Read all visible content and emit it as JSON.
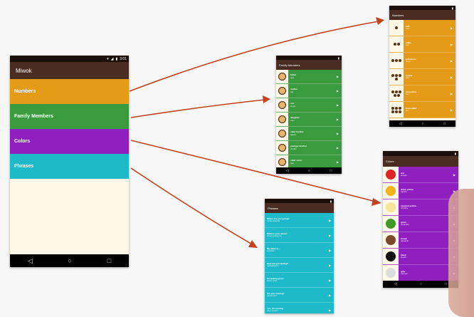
{
  "main": {
    "status_time": "3:01",
    "title": "Miwok",
    "categories": [
      {
        "label": "Numbers",
        "color": "#e39b18"
      },
      {
        "label": "Family Members",
        "color": "#3a9a3e"
      },
      {
        "label": "Colors",
        "color": "#8f1fbf"
      },
      {
        "label": "Phrases",
        "color": "#1fbac9"
      }
    ]
  },
  "numbers_screen": {
    "title": "Numbers",
    "color": "#e39b18",
    "items": [
      {
        "miwok": "lutti",
        "english": "one"
      },
      {
        "miwok": "otiiko",
        "english": "two"
      },
      {
        "miwok": "tolookosu",
        "english": "three"
      },
      {
        "miwok": "oyyisa",
        "english": "four"
      },
      {
        "miwok": "massokka",
        "english": "five"
      },
      {
        "miwok": "temmokka",
        "english": "six"
      }
    ]
  },
  "family_screen": {
    "title": "Family Members",
    "color": "#3a9a3e",
    "items": [
      {
        "miwok": "father",
        "english": "әpә"
      },
      {
        "miwok": "mother",
        "english": "әṭa"
      },
      {
        "miwok": "son",
        "english": "angsi"
      },
      {
        "miwok": "daughter",
        "english": "tune"
      },
      {
        "miwok": "older brother",
        "english": "taachi"
      },
      {
        "miwok": "younger brother",
        "english": "chalitti"
      },
      {
        "miwok": "older sister",
        "english": "teṭe"
      }
    ]
  },
  "colors_screen": {
    "title": "Colors",
    "color": "#8f1fbf",
    "items": [
      {
        "miwok": "red",
        "english": "weṭeṭṭi",
        "swatch": "#e02424"
      },
      {
        "miwok": "dusty yellow",
        "english": "ṭopiisә",
        "swatch": "#f2b21b"
      },
      {
        "miwok": "mustard yellow",
        "english": "chiwiiṭә",
        "swatch": "#f6e59a"
      },
      {
        "miwok": "green",
        "english": "chokokki",
        "swatch": "#3f9a2a"
      },
      {
        "miwok": "brown",
        "english": "ṭakaakki",
        "swatch": "#7b4a2a"
      },
      {
        "miwok": "black",
        "english": "kululli",
        "swatch": "#111111"
      },
      {
        "miwok": "gray",
        "english": "ṭopoppi",
        "swatch": "#dddddd"
      }
    ]
  },
  "phrases_screen": {
    "title": "Phrases",
    "color": "#1fbac9",
    "items": [
      {
        "miwok": "Where are you going?",
        "english": "minto wuksus"
      },
      {
        "miwok": "What is your name?",
        "english": "tinnә oyaase'nә"
      },
      {
        "miwok": "My name is...",
        "english": "oyaaset..."
      },
      {
        "miwok": "How are you feeling?",
        "english": "michәksәs?"
      },
      {
        "miwok": "I'm feeling good.",
        "english": "kuchi achit"
      },
      {
        "miwok": "Are you coming?",
        "english": "әәnәs'aa?"
      },
      {
        "miwok": "Yes, I'm coming.",
        "english": "hәә' әәnәm"
      }
    ]
  },
  "icons": {
    "play": "▶",
    "back": "◁",
    "home": "○",
    "recents": "□"
  }
}
